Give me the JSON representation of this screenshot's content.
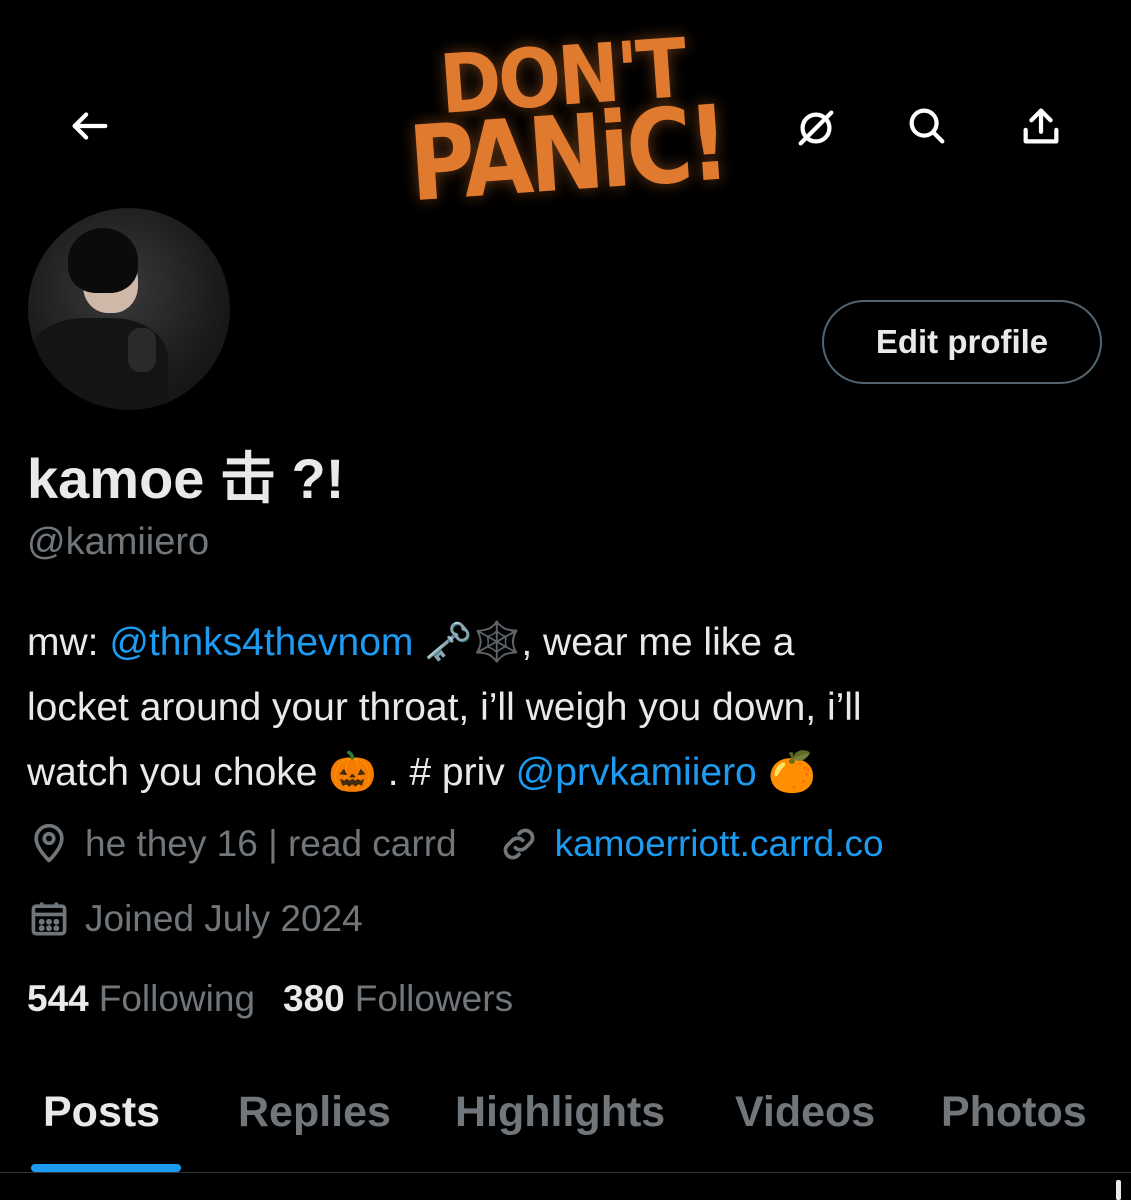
{
  "banner": {
    "line1": "DON'T",
    "line2": "PANiC!"
  },
  "header": {
    "icons": [
      "back-arrow-icon",
      "block-icon",
      "search-icon",
      "share-icon"
    ]
  },
  "profile": {
    "edit_button": "Edit profile",
    "display_name": "kamoe 击 ?!",
    "handle": "@kamiiero",
    "bio": {
      "line1_prefix": "mw: ",
      "line1_mention": "@thnks4thevnom",
      "line1_suffix": " 🗝️🕸️, wear me like a",
      "line2": "locket around your throat, i’ll weigh you down, i’ll",
      "line3_prefix": "watch you choke 🎃 . # priv ",
      "line3_mention": "@prvkamiiero",
      "line3_suffix": " 🍊"
    },
    "location": "he they 16 | read carrd",
    "website": "kamoerriott.carrd.co",
    "joined": "Joined July 2024",
    "stats": {
      "following_count": "544",
      "following_label": "Following",
      "followers_count": "380",
      "followers_label": "Followers"
    }
  },
  "tabs": [
    {
      "label": "Posts",
      "active": true
    },
    {
      "label": "Replies"
    },
    {
      "label": "Highlights"
    },
    {
      "label": "Videos"
    },
    {
      "label": "Photos"
    }
  ],
  "colors": {
    "accent": "#1d9bf0",
    "muted": "#71767b",
    "text": "#e7e9ea",
    "banner_text": "#e07a2e"
  }
}
